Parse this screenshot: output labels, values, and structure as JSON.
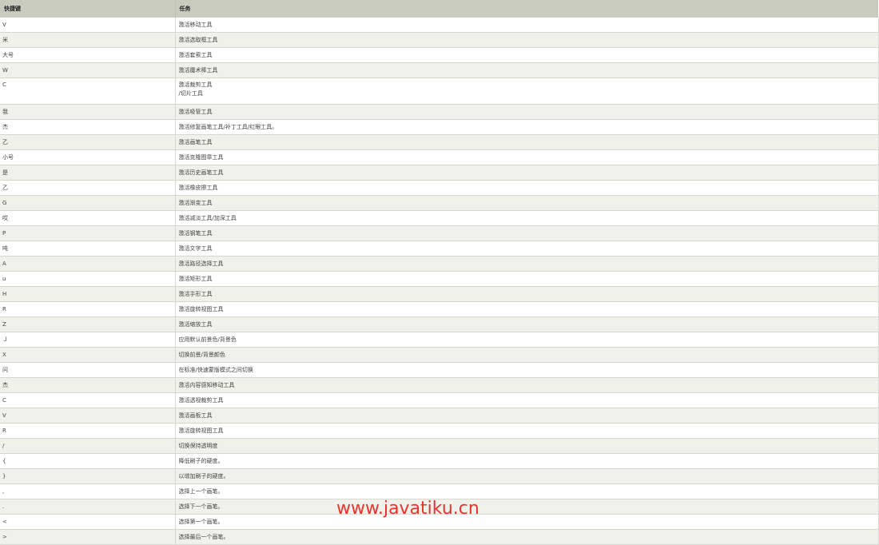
{
  "table": {
    "headers": [
      "快捷键",
      "任务"
    ],
    "rows": [
      {
        "key": "V",
        "task": "激活移动工具"
      },
      {
        "key": "米",
        "task": "激活选取框工具"
      },
      {
        "key": "大号",
        "task": "激活套索工具"
      },
      {
        "key": "W",
        "task": "激活魔术棒工具"
      },
      {
        "key": "C",
        "task": "激活裁剪工具\n/切片工具"
      },
      {
        "key": "我",
        "task": "激活吸管工具"
      },
      {
        "key": "杰",
        "task": "激活修复画笔工具/补丁工具/红眼工具。"
      },
      {
        "key": "乙",
        "task": "激活画笔工具"
      },
      {
        "key": "小号",
        "task": "激活克隆图章工具"
      },
      {
        "key": "是",
        "task": "激活历史画笔工具"
      },
      {
        "key": "乙",
        "task": "激活橡皮擦工具"
      },
      {
        "key": "G",
        "task": "激活渐变工具"
      },
      {
        "key": "哎",
        "task": "激活减淡工具/加深工具"
      },
      {
        "key": "P",
        "task": "激活钢笔工具"
      },
      {
        "key": "吨",
        "task": "激活文字工具"
      },
      {
        "key": "A",
        "task": "激活路径选择工具"
      },
      {
        "key": "u",
        "task": "激活矩形工具"
      },
      {
        "key": "H",
        "task": "激活手形工具"
      },
      {
        "key": "R",
        "task": "激活旋转视图工具"
      },
      {
        "key": "Z",
        "task": "激活缩放工具"
      },
      {
        "key": "Ｊ",
        "task": "应用默认前景色/背景色"
      },
      {
        "key": "X",
        "task": "切换前景/背景颜色"
      },
      {
        "key": "问",
        "task": "在标准/快速蒙版模式之间切换"
      },
      {
        "key": "杰",
        "task": "激活内容感知移动工具"
      },
      {
        "key": "C",
        "task": "激活透视裁剪工具"
      },
      {
        "key": "V",
        "task": "激活画板工具"
      },
      {
        "key": "R",
        "task": "激活旋转视图工具"
      },
      {
        "key": "/",
        "task": "切换保持透明度"
      },
      {
        "key": "{",
        "task": "降低刷子的硬度。"
      },
      {
        "key": "}",
        "task": "以增加刷子的硬度。"
      },
      {
        "key": ",",
        "task": "选择上一个画笔。"
      },
      {
        "key": ".",
        "task": "选择下一个画笔。"
      },
      {
        "key": "<",
        "task": "选择第一个画笔。"
      },
      {
        "key": ">",
        "task": "选择最后一个画笔。"
      }
    ]
  },
  "watermark": "www.javatiku.cn"
}
